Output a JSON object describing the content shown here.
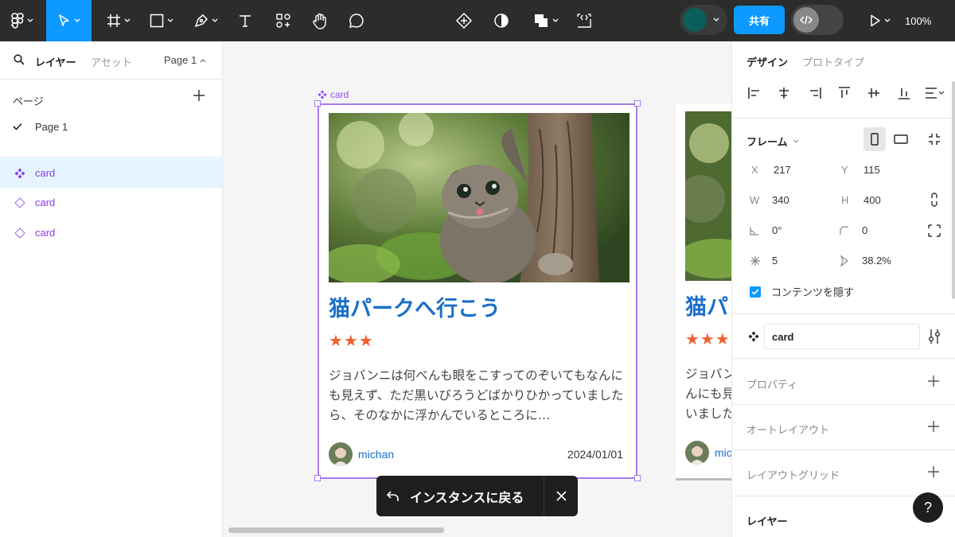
{
  "toolbar": {
    "share_label": "共有",
    "zoom": "100%"
  },
  "left_panel": {
    "tabs": {
      "layers": "レイヤー",
      "assets": "アセット"
    },
    "page_selector": "Page 1",
    "pages_title": "ページ",
    "pages": [
      "Page 1"
    ],
    "layers": [
      {
        "name": "card",
        "selected": true
      },
      {
        "name": "card",
        "selected": false
      },
      {
        "name": "card",
        "selected": false
      }
    ]
  },
  "canvas": {
    "frame_label": "card",
    "card": {
      "title": "猫パークへ行こう",
      "rating": "★★★",
      "description": "ジョバンニは何べんも眼をこすってのぞいてもなんにも見えず、ただ黒いびろうどばかりひかっていましたら、そのなかに浮かんでいるところに…",
      "author": "michan",
      "date": "2024/01/01"
    },
    "card2": {
      "title": "猫パ",
      "rating": "★★★",
      "description": "ジョバンニ\nんにも見え\nいましたら",
      "author": "mic"
    },
    "toast": {
      "label": "インスタンスに戻る"
    }
  },
  "right_panel": {
    "tabs": {
      "design": "デザイン",
      "prototype": "プロトタイプ"
    },
    "frame_title": "フレーム",
    "x": "217",
    "y": "115",
    "w": "340",
    "h": "400",
    "rotation": "0°",
    "corner_radius": "0",
    "count": "5",
    "ratio": "38.2%",
    "clip_content_label": "コンテンツを隠す",
    "clip_content": true,
    "component_name": "card",
    "sections": [
      "プロパティ",
      "オートレイアウト",
      "レイアウトグリッド"
    ],
    "layer_section": "レイヤー",
    "help": "?"
  },
  "colors": {
    "accent": "#0d99ff",
    "component_purple": "#9747ff",
    "title_blue": "#1a6fc9",
    "star_orange": "#f06030"
  }
}
